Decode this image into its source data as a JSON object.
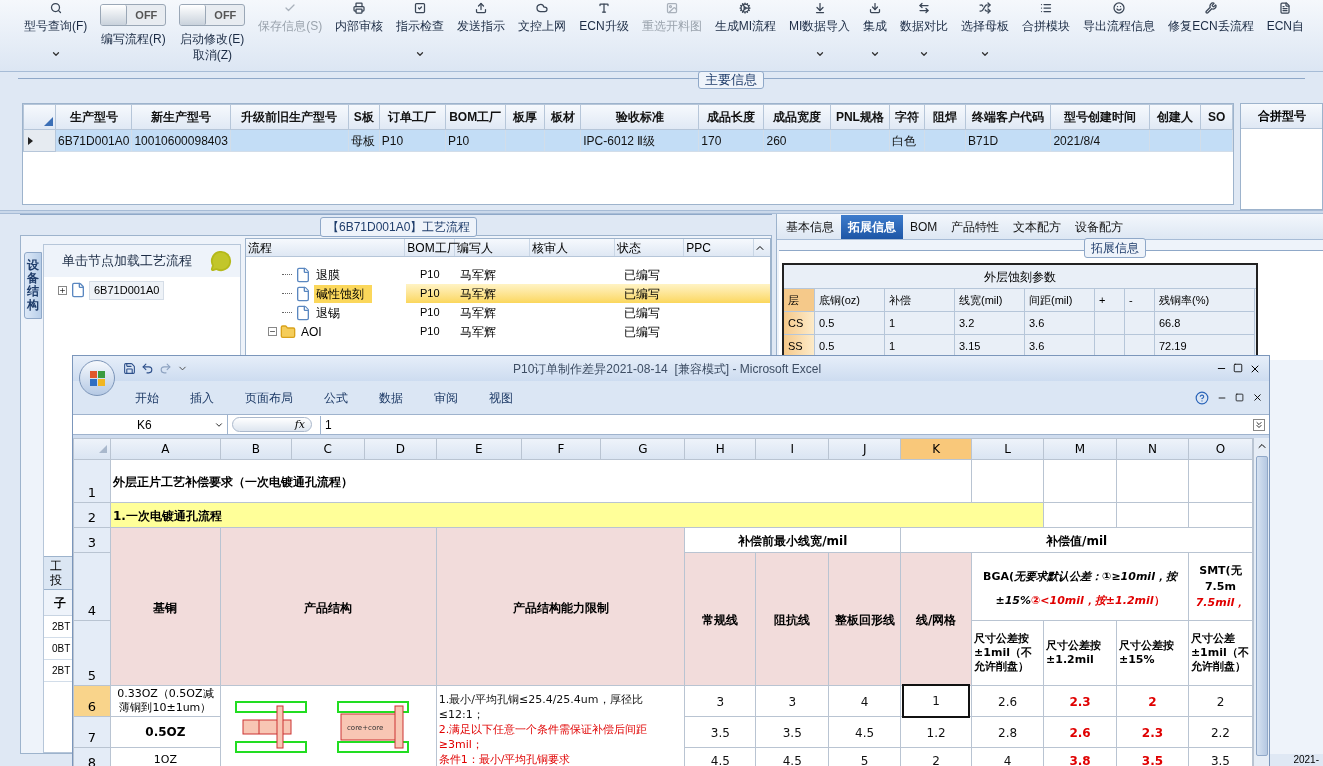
{
  "toolbar": {
    "items": [
      {
        "kind": "button",
        "label": "型号查询(F)",
        "dropdown": true,
        "disabled": false
      },
      {
        "kind": "toggle",
        "label": "编写流程(R)",
        "switch_text": "OFF",
        "on": false
      },
      {
        "kind": "toggle",
        "label": "启动修改(E)",
        "sublabel": "取消(Z)",
        "switch_text": "OFF",
        "on": false
      },
      {
        "kind": "button",
        "label": "保存信息(S)",
        "dropdown": false,
        "disabled": true
      },
      {
        "kind": "button",
        "label": "内部审核",
        "dropdown": false,
        "disabled": false
      },
      {
        "kind": "button",
        "label": "指示检查",
        "dropdown": true,
        "disabled": false
      },
      {
        "kind": "button",
        "label": "发送指示",
        "dropdown": false,
        "disabled": false
      },
      {
        "kind": "button",
        "label": "文控上网",
        "dropdown": false,
        "disabled": false
      },
      {
        "kind": "button",
        "label": "ECN升级",
        "dropdown": false,
        "disabled": false
      },
      {
        "kind": "button",
        "label": "重选开料图",
        "dropdown": false,
        "disabled": true
      },
      {
        "kind": "button",
        "label": "生成MI流程",
        "dropdown": false,
        "disabled": false
      },
      {
        "kind": "button",
        "label": "MI数据导入",
        "dropdown": true,
        "disabled": false
      },
      {
        "kind": "button",
        "label": "集成",
        "dropdown": true,
        "disabled": false
      },
      {
        "kind": "button",
        "label": "数据对比",
        "dropdown": true,
        "disabled": false
      },
      {
        "kind": "button",
        "label": "选择母板",
        "dropdown": true,
        "disabled": false
      },
      {
        "kind": "button",
        "label": "合拼模块",
        "dropdown": false,
        "disabled": false
      },
      {
        "kind": "button",
        "label": "导出流程信息",
        "dropdown": false,
        "disabled": false
      },
      {
        "kind": "button",
        "label": "修复ECN丢流程",
        "dropdown": false,
        "disabled": false
      },
      {
        "kind": "button",
        "label": "ECN自",
        "dropdown": false,
        "disabled": false
      }
    ]
  },
  "main_info": {
    "title": "主要信息",
    "columns": [
      "生产型号",
      "新生产型号",
      "升级前旧生产型号",
      "S板",
      "订单工厂",
      "BOM工厂",
      "板厚",
      "板材",
      "验收标准",
      "成品长度",
      "成品宽度",
      "PNL规格",
      "字符",
      "阻焊",
      "终端客户代码",
      "型号创建时间",
      "创建人",
      "SO"
    ],
    "rows": [
      {
        "selected": true,
        "cells": [
          "6B71D001A0",
          "10010600098403",
          null,
          "母板",
          "P10",
          "P10",
          null,
          null,
          "IPC-6012 Ⅱ级",
          "170",
          "260",
          null,
          "白色",
          null,
          "B71D",
          "2021/8/4",
          null,
          null
        ]
      }
    ],
    "side_header": "合拼型号"
  },
  "process_panel": {
    "title": "【6B71D001A0】工艺流程",
    "side_tab": "设备结构",
    "hint": "单击节点加载工艺流程",
    "tree": [
      {
        "label": "6B71D001A0",
        "expanded": false
      }
    ],
    "lower_texts": [
      "工",
      "投"
    ],
    "lower_header": "子",
    "lower_rows": [
      "2BT",
      "0BT",
      "2BT"
    ],
    "grid_columns": [
      "流程",
      "BOM工厂",
      "编写人",
      "核审人",
      "状态",
      "PPC"
    ],
    "grid_rows": [
      {
        "label": "退膜",
        "kind": "file",
        "selected": false,
        "bom": "P10",
        "writer": "马军辉",
        "status": "已编写"
      },
      {
        "label": "碱性蚀刻",
        "kind": "file",
        "selected": true,
        "bom": "P10",
        "writer": "马军辉",
        "status": "已编写"
      },
      {
        "label": "退锡",
        "kind": "file",
        "selected": false,
        "bom": "P10",
        "writer": "马军辉",
        "status": "已编写"
      },
      {
        "label": "AOI",
        "kind": "folder",
        "expanded": true,
        "selected": false,
        "bom": "P10",
        "writer": "马军辉",
        "status": "已编写"
      }
    ]
  },
  "detail_panel": {
    "tabs": [
      {
        "label": "基本信息",
        "selected": false
      },
      {
        "label": "拓展信息",
        "selected": true
      },
      {
        "label": "BOM",
        "selected": false
      },
      {
        "label": "产品特性",
        "selected": false
      },
      {
        "label": "文本配方",
        "selected": false
      },
      {
        "label": "设备配方",
        "selected": false
      }
    ],
    "group_title": "拓展信息",
    "table_title": "外层蚀刻参数",
    "columns": [
      "层",
      "底铜(oz)",
      "补偿",
      "线宽(mil)",
      "间距(mil)",
      "+",
      "-",
      "残铜率(%)"
    ],
    "rows": [
      {
        "cells": [
          "CS",
          "0.5",
          "1",
          "3.2",
          "3.6",
          null,
          null,
          "66.8"
        ]
      },
      {
        "cells": [
          "SS",
          "0.5",
          "1",
          "3.15",
          "3.6",
          null,
          null,
          "72.19"
        ]
      }
    ]
  },
  "status_bar": {
    "date": "2021-"
  },
  "excel": {
    "title": "P10订单制作差异2021-08-14  [兼容模式] - Microsoft Excel",
    "ribbon_tabs": [
      "开始",
      "插入",
      "页面布局",
      "公式",
      "数据",
      "审阅",
      "视图"
    ],
    "name_box": "K6",
    "function_label": "fx",
    "formula": "1",
    "columns": [
      {
        "label": "A",
        "selected": false
      },
      {
        "label": "B",
        "selected": false
      },
      {
        "label": "C",
        "selected": false
      },
      {
        "label": "D",
        "selected": false
      },
      {
        "label": "E",
        "selected": false
      },
      {
        "label": "F",
        "selected": false
      },
      {
        "label": "G",
        "selected": false
      },
      {
        "label": "H",
        "selected": false
      },
      {
        "label": "I",
        "selected": false
      },
      {
        "label": "J",
        "selected": false
      },
      {
        "label": "K",
        "selected": true
      },
      {
        "label": "L",
        "selected": false
      },
      {
        "label": "M",
        "selected": false
      },
      {
        "label": "N",
        "selected": false
      },
      {
        "label": "O",
        "selected": false
      }
    ],
    "row_numbers": [
      {
        "label": "1",
        "selected": false
      },
      {
        "label": "2",
        "selected": false
      },
      {
        "label": "3",
        "selected": false
      },
      {
        "label": "4",
        "selected": false
      },
      {
        "label": "5",
        "selected": false
      },
      {
        "label": "6",
        "selected": true
      },
      {
        "label": "7",
        "selected": false
      },
      {
        "label": "8",
        "selected": false
      }
    ],
    "sheet_title": "外层正片工艺补偿要求（一次电镀通孔流程）",
    "section": "1.一次电镀通孔流程",
    "headers": {
      "base_copper": "基铜",
      "structure": "产品结构",
      "limits": "产品结构能力限制",
      "min_width": "补偿前最小线宽/mil",
      "min_width_cols": [
        "常规线",
        "阻抗线",
        "整板回形线"
      ],
      "compensation": "补偿值/mil",
      "line_grid": "线/网格",
      "bga": "BGA(*无要求默认公差：①≥10mil，按±15%*",
      "bga_note": "*②<10mil，按±1.2mil*）",
      "smt_lines": [
        "SMT(无",
        "7.5m"
      ],
      "smt_note": "7.5mil，",
      "sub_cols": [
        "尺寸公差按±1mil（不允许削盘）",
        "尺寸公差按±1.2mil",
        "尺寸公差按±15%",
        "尺寸公差±1mil（不允许削盘）"
      ]
    },
    "structure_label": "core+core",
    "limits": [
      {
        "text": "1.最小/平均孔铜≤25.4/25.4um，厚径比≤12:1；",
        "emphasis": false
      },
      {
        "text": "2.满足以下任意一个条件需保证补偿后间距≥3mil；",
        "emphasis": true
      },
      {
        "text": "条件1：最小/平均孔铜要求",
        "emphasis": true
      }
    ],
    "data_rows": [
      {
        "base": "0.33OZ（0.5OZ减薄铜到10±1um）",
        "bold": false,
        "values": [
          {
            "text": "3",
            "highlight": false,
            "selected": false
          },
          {
            "text": "3",
            "highlight": false,
            "selected": false
          },
          {
            "text": "4",
            "highlight": false,
            "selected": false
          },
          {
            "text": "1",
            "highlight": false,
            "selected": true
          },
          {
            "text": "2.6",
            "highlight": false,
            "selected": false
          },
          {
            "text": "2.3",
            "highlight": true,
            "selected": false
          },
          {
            "text": "2",
            "highlight": true,
            "selected": false
          },
          {
            "text": "2",
            "highlight": false,
            "selected": false
          }
        ]
      },
      {
        "base": "0.5OZ",
        "bold": true,
        "values": [
          {
            "text": "3.5",
            "highlight": false,
            "selected": false
          },
          {
            "text": "3.5",
            "highlight": false,
            "selected": false
          },
          {
            "text": "4.5",
            "highlight": false,
            "selected": false
          },
          {
            "text": "1.2",
            "highlight": false,
            "selected": false
          },
          {
            "text": "2.8",
            "highlight": false,
            "selected": false
          },
          {
            "text": "2.6",
            "highlight": true,
            "selected": false
          },
          {
            "text": "2.3",
            "highlight": true,
            "selected": false
          },
          {
            "text": "2.2",
            "highlight": false,
            "selected": false
          }
        ]
      },
      {
        "base": "1OZ",
        "bold": false,
        "values": [
          {
            "text": "4.5",
            "highlight": false,
            "selected": false
          },
          {
            "text": "4.5",
            "highlight": false,
            "selected": false
          },
          {
            "text": "5",
            "highlight": false,
            "selected": false
          },
          {
            "text": "2",
            "highlight": false,
            "selected": false
          },
          {
            "text": "4",
            "highlight": false,
            "selected": false
          },
          {
            "text": "3.8",
            "highlight": true,
            "selected": false
          },
          {
            "text": "3.5",
            "highlight": true,
            "selected": false
          },
          {
            "text": "3.5",
            "highlight": false,
            "selected": false
          }
        ]
      }
    ]
  }
}
